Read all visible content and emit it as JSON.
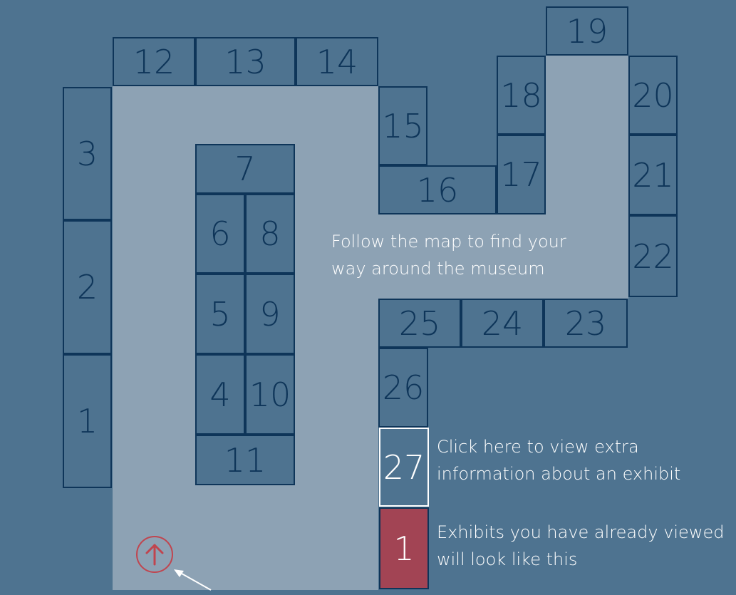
{
  "rooms": {
    "r1": "1",
    "r2": "2",
    "r3": "3",
    "r4": "4",
    "r5": "5",
    "r6": "6",
    "r7": "7",
    "r8": "8",
    "r9": "9",
    "r10": "10",
    "r11": "11",
    "r12": "12",
    "r13": "13",
    "r14": "14",
    "r15": "15",
    "r16": "16",
    "r17": "17",
    "r18": "18",
    "r19": "19",
    "r20": "20",
    "r21": "21",
    "r22": "22",
    "r23": "23",
    "r24": "24",
    "r25": "25",
    "r26": "26"
  },
  "legend": {
    "info_room": "27",
    "visited_room": "1",
    "map_hint_line1": "Follow the map to find your",
    "map_hint_line2": "way around the museum",
    "info_hint_line1": "Click here to view extra",
    "info_hint_line2": "information about an exhibit",
    "visited_hint_line1": "Exhibits you have already viewed",
    "visited_hint_line2": "will look like this"
  },
  "icons": {
    "entrance": "up-arrow-circle-icon",
    "pointer": "arrow-icon"
  },
  "colors": {
    "background": "#4e7390",
    "corridor": "#8da2b4",
    "room_border": "#0e3559",
    "visited": "#a24454",
    "entrance": "#c0454f"
  }
}
